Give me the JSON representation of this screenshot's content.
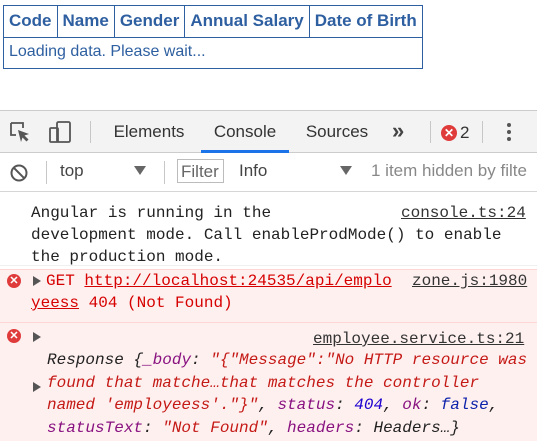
{
  "table": {
    "headers": [
      "Code",
      "Name",
      "Gender",
      "Annual Salary",
      "Date of Birth"
    ],
    "loading_text": "Loading data. Please wait..."
  },
  "devtools": {
    "tabs": [
      {
        "label": "Elements",
        "active": false
      },
      {
        "label": "Console",
        "active": true
      },
      {
        "label": "Sources",
        "active": false
      }
    ],
    "more_tabs": "»",
    "error_count": "2",
    "toolbar": {
      "context": "top",
      "filter_placeholder": "Filter",
      "level": "Info",
      "hidden_note": "1 item hidden by filte"
    },
    "messages": {
      "info": {
        "text": "Angular is running in the\ndevelopment mode. Call enableProdMode() to enable\nthe production mode.",
        "source": "console.ts:24"
      },
      "get_error": {
        "method": "GET",
        "url": "http://localhost:24535/api/emplo",
        "continuation": "yeess",
        "status": "404 (Not Found)",
        "source": "zone.js:1980"
      },
      "object_error": {
        "source": "employee.service.ts:21",
        "class_name": "Response",
        "body_key": "_body",
        "body_value": "\"{\"Message\":\"No HTTP resource was found that matche…that matches the controller named 'employeess'.\"}\"",
        "status_key": "status",
        "status_value": "404",
        "ok_key": "ok",
        "ok_value": "false",
        "status_text_key": "statusText",
        "status_text_value": "\"Not Found\"",
        "headers_key": "headers",
        "headers_value": "Headers…}"
      }
    },
    "colors": {
      "accent": "#1a73e8",
      "error_red": "#e03b3b",
      "table_blue": "#2e5fa0"
    }
  }
}
